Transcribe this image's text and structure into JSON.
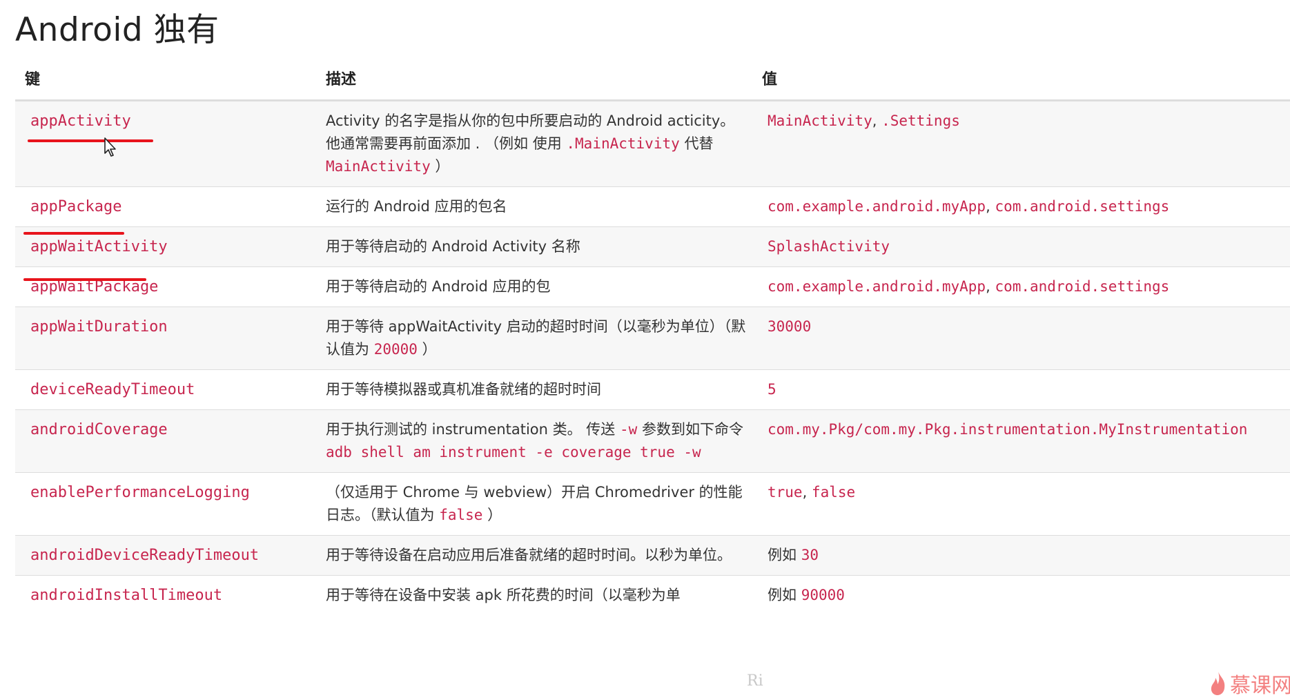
{
  "page_title": "Android 独有",
  "headers": {
    "key": "键",
    "desc": "描述",
    "value": "值"
  },
  "rows": [
    {
      "key": "appActivity",
      "desc": [
        {
          "t": "Activity 的名字是指从你的包中所要启动的 Android acticity。他通常需要再前面添加 . （例如 使用 "
        },
        {
          "c": ".MainActivity"
        },
        {
          "t": " 代替 "
        },
        {
          "c": "MainActivity"
        },
        {
          "t": " ）"
        }
      ],
      "value": [
        {
          "c": "MainActivity"
        },
        {
          "t": ", "
        },
        {
          "c": ".Settings"
        }
      ]
    },
    {
      "key": "appPackage",
      "desc": [
        {
          "t": "运行的 Android 应用的包名"
        }
      ],
      "value": [
        {
          "c": "com.example.android.myApp"
        },
        {
          "t": ", "
        },
        {
          "c": "com.android.settings"
        }
      ]
    },
    {
      "key": "appWaitActivity",
      "desc": [
        {
          "t": "用于等待启动的 Android Activity 名称"
        }
      ],
      "value": [
        {
          "c": "SplashActivity"
        }
      ]
    },
    {
      "key": "appWaitPackage",
      "desc": [
        {
          "t": "用于等待启动的 Android 应用的包"
        }
      ],
      "value": [
        {
          "c": "com.example.android.myApp"
        },
        {
          "t": ", "
        },
        {
          "c": "com.android.settings"
        }
      ]
    },
    {
      "key": "appWaitDuration",
      "desc": [
        {
          "t": "用于等待 appWaitActivity 启动的超时时间（以毫秒为单位）（默认值为 "
        },
        {
          "c": "20000"
        },
        {
          "t": " ）"
        }
      ],
      "value": [
        {
          "c": "30000"
        }
      ]
    },
    {
      "key": "deviceReadyTimeout",
      "desc": [
        {
          "t": "用于等待模拟器或真机准备就绪的超时时间"
        }
      ],
      "value": [
        {
          "c": "5"
        }
      ]
    },
    {
      "key": "androidCoverage",
      "desc": [
        {
          "t": "用于执行测试的 instrumentation 类。 传送 "
        },
        {
          "c": "-w"
        },
        {
          "t": " 参数到如下命令 "
        },
        {
          "c": "adb shell am instrument -e coverage true -w"
        }
      ],
      "value": [
        {
          "c": "com.my.Pkg/com.my.Pkg.instrumentation.MyInstrumentation"
        }
      ]
    },
    {
      "key": "enablePerformanceLogging",
      "desc": [
        {
          "t": "（仅适用于 Chrome 与 webview）开启 Chromedriver 的性能日志。（默认值为 "
        },
        {
          "c": "false"
        },
        {
          "t": " ）"
        }
      ],
      "value": [
        {
          "c": "true"
        },
        {
          "t": ", "
        },
        {
          "c": "false"
        }
      ]
    },
    {
      "key": "androidDeviceReadyTimeout",
      "desc": [
        {
          "t": "用于等待设备在启动应用后准备就绪的超时时间。以秒为单位。"
        }
      ],
      "value": [
        {
          "t": "例如 "
        },
        {
          "c": "30"
        }
      ]
    },
    {
      "key": "androidInstallTimeout",
      "desc": [
        {
          "t": "用于等待在设备中安装 apk 所花费的时间（以毫秒为单"
        }
      ],
      "value": [
        {
          "t": "例如 "
        },
        {
          "c": "90000"
        }
      ]
    }
  ],
  "watermark": {
    "logo_text": "慕课网",
    "corner_mark": "Ri"
  },
  "colors": {
    "code": "#c7254e",
    "underline": "#e8141c",
    "logo": "#f26b6b"
  },
  "icons": [
    "cursor-arrow-icon",
    "flame-logo-icon"
  ]
}
